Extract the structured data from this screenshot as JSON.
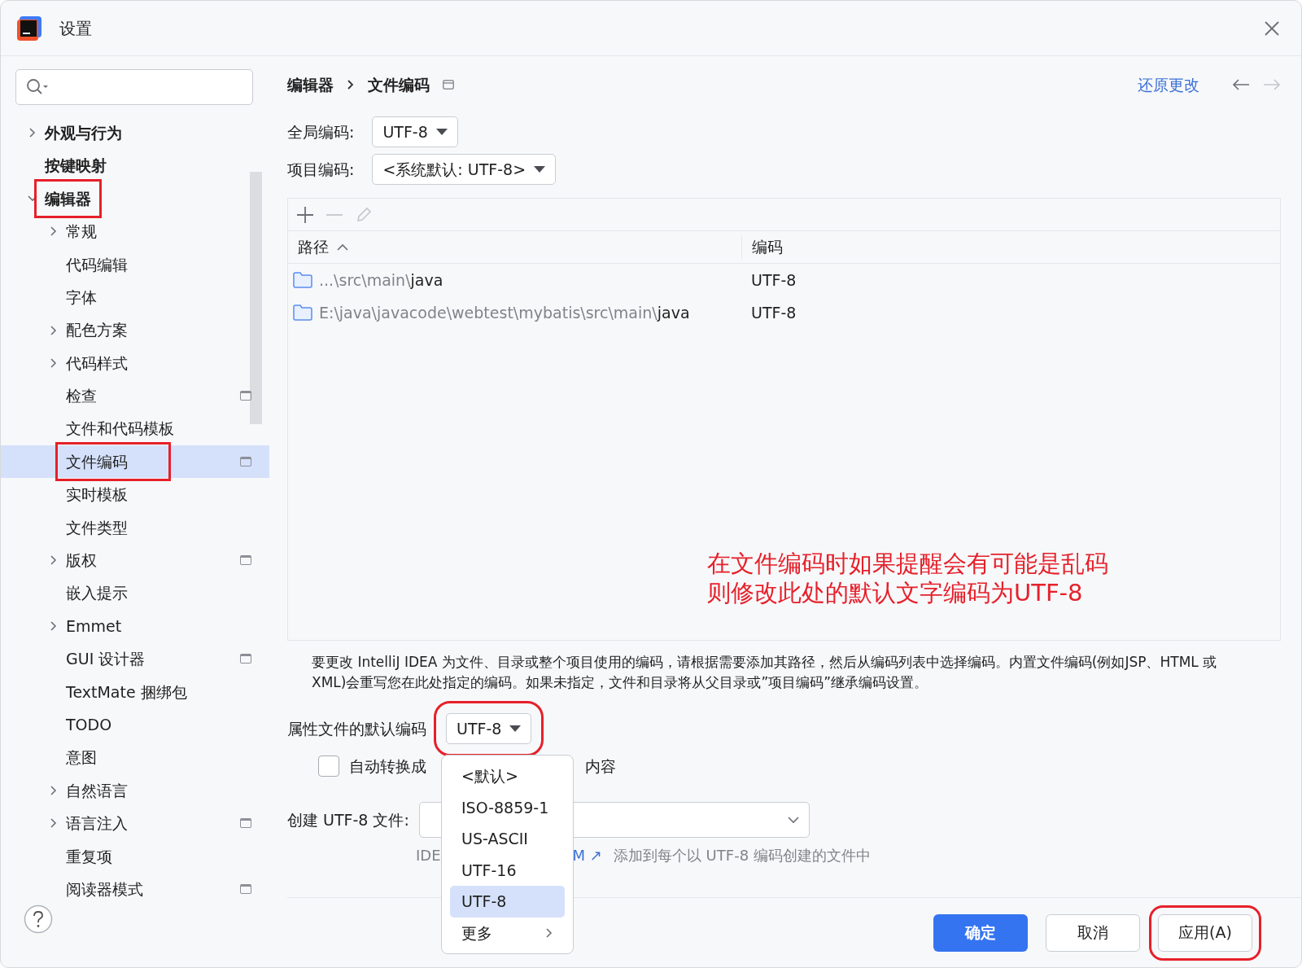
{
  "window": {
    "title": "设置"
  },
  "sidebar": {
    "items": [
      {
        "label": "外观与行为",
        "kind": "group",
        "expanded": false,
        "selected": false
      },
      {
        "label": "按键映射",
        "kind": "page",
        "selected": false
      },
      {
        "label": "编辑器",
        "kind": "group",
        "expanded": true,
        "selected": false,
        "highlighted": true,
        "children": [
          {
            "label": "常规",
            "kind": "group",
            "expanded": false,
            "selected": false
          },
          {
            "label": "代码编辑",
            "kind": "page",
            "selected": false
          },
          {
            "label": "字体",
            "kind": "page",
            "selected": false
          },
          {
            "label": "配色方案",
            "kind": "group",
            "expanded": false,
            "selected": false
          },
          {
            "label": "代码样式",
            "kind": "group",
            "expanded": false,
            "selected": false
          },
          {
            "label": "检查",
            "kind": "page",
            "selected": false,
            "project_level": true
          },
          {
            "label": "文件和代码模板",
            "kind": "page",
            "selected": false
          },
          {
            "label": "文件编码",
            "kind": "page",
            "selected": true,
            "project_level": true,
            "highlighted": true
          },
          {
            "label": "实时模板",
            "kind": "page",
            "selected": false
          },
          {
            "label": "文件类型",
            "kind": "page",
            "selected": false
          },
          {
            "label": "版权",
            "kind": "group",
            "expanded": false,
            "selected": false,
            "project_level": true
          },
          {
            "label": "嵌入提示",
            "kind": "page",
            "selected": false
          },
          {
            "label": "Emmet",
            "kind": "group",
            "expanded": false,
            "selected": false
          },
          {
            "label": "GUI 设计器",
            "kind": "page",
            "selected": false,
            "project_level": true
          },
          {
            "label": "TextMate 捆绑包",
            "kind": "page",
            "selected": false
          },
          {
            "label": "TODO",
            "kind": "page",
            "selected": false
          },
          {
            "label": "意图",
            "kind": "page",
            "selected": false
          },
          {
            "label": "自然语言",
            "kind": "group",
            "expanded": false,
            "selected": false
          },
          {
            "label": "语言注入",
            "kind": "group",
            "expanded": false,
            "selected": false,
            "project_level": true
          },
          {
            "label": "重复项",
            "kind": "page",
            "selected": false
          },
          {
            "label": "阅读器模式",
            "kind": "page",
            "selected": false,
            "project_level": true
          }
        ]
      }
    ]
  },
  "breadcrumb": [
    "编辑器",
    "文件编码"
  ],
  "reset_link": "还原更改",
  "nav": {
    "back_enabled": true,
    "forward_enabled": false
  },
  "global_encoding": {
    "label": "全局编码:",
    "value": "UTF-8"
  },
  "project_encoding": {
    "label": "项目编码:",
    "value": "<系统默认: UTF-8>"
  },
  "toolbar": {
    "add_enabled": true,
    "remove_enabled": false,
    "edit_enabled": false
  },
  "table": {
    "columns": [
      {
        "label": "路径",
        "sorted": true
      },
      {
        "label": "编码"
      }
    ],
    "rows": [
      {
        "path_dim": "...\\src\\main\\",
        "path_name": "java",
        "encoding": "UTF-8"
      },
      {
        "path_dim": "E:\\java\\javacode\\webtest\\mybatis\\src\\main\\",
        "path_name": "java",
        "encoding": "UTF-8"
      }
    ]
  },
  "annotation": [
    "在文件编码时如果提醒会有可能是乱码",
    "则修改此处的默认文字编码为UTF-8"
  ],
  "description": "要更改 IntelliJ IDEA 为文件、目录或整个项目使用的编码，请根据需要添加其路径，然后从编码列表中选择编码。内置文件编码(例如JSP、HTML 或 XML)会重写您在此处指定的编码。如果未指定，文件和目录将从父目录或”项目编码”继承编码设置。",
  "properties_encoding": {
    "label": "属性文件的默认编码",
    "value": "UTF-8",
    "highlighted": true
  },
  "auto_convert": {
    "checked": false,
    "label_start": "自动转换成",
    "label_end": "内容"
  },
  "create_utf8": {
    "label": "创建 UTF-8 文件:"
  },
  "hint": {
    "start": "IDE",
    "link": "M ↗",
    "text": "添加到每个以 UTF-8 编码创建的文件中"
  },
  "dropdown_menu": {
    "items": [
      {
        "label": "<默认>",
        "selected": false,
        "submenu": false
      },
      {
        "label": "ISO-8859-1",
        "selected": false,
        "submenu": false
      },
      {
        "label": "US-ASCII",
        "selected": false,
        "submenu": false
      },
      {
        "label": "UTF-16",
        "selected": false,
        "submenu": false
      },
      {
        "label": "UTF-8",
        "selected": true,
        "submenu": false
      },
      {
        "label": "更多",
        "selected": false,
        "submenu": true
      }
    ]
  },
  "buttons": [
    {
      "label": "确定",
      "kind": "primary",
      "highlighted": false
    },
    {
      "label": "取消",
      "kind": "default",
      "highlighted": false
    },
    {
      "label": "应用(A)",
      "kind": "default",
      "highlighted": true
    }
  ]
}
